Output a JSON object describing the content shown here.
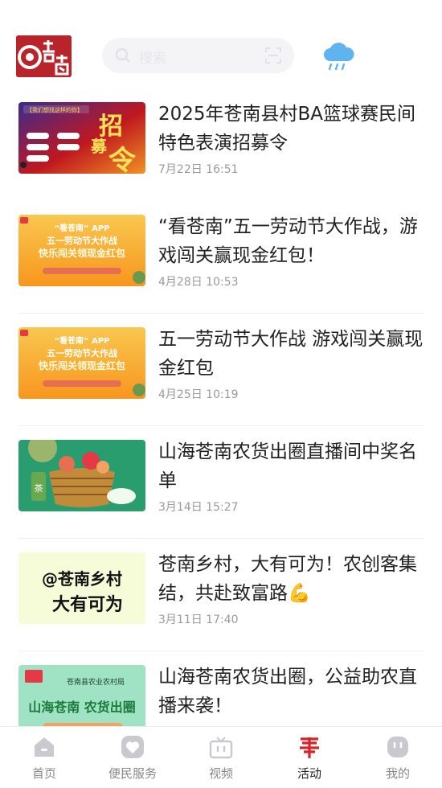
{
  "header": {
    "logo_text": "看苍南",
    "search_placeholder": "搜索",
    "weather_icon": "rain-cloud-icon"
  },
  "feed": [
    {
      "title": "2025年苍南县村BA篮球赛民间特色表演招募令",
      "time": "7月22日 16:51",
      "thumb": {
        "kind": "recruit",
        "caption": "【我们想找这样的你】",
        "big": "招募令"
      }
    },
    {
      "title": "“看苍南”五一劳动节大作战，游戏闯关赢现金红包！",
      "time": "4月28日 10:53",
      "thumb": {
        "kind": "mayday",
        "line1": "“看苍南” APP",
        "line2": "五一劳动节大作战",
        "line3": "快乐闯关领现金红包"
      }
    },
    {
      "title": "五一劳动节大作战 游戏闯关赢现金红包",
      "time": "4月25日 10:19",
      "thumb": {
        "kind": "mayday",
        "line1": "“看苍南” APP",
        "line2": "五一劳动节大作战",
        "line3": "快乐闯关领现金红包"
      }
    },
    {
      "title": "山海苍南农货出圈直播间中奖名单",
      "time": "3月14日 15:27",
      "thumb": {
        "kind": "basket",
        "tag": "茶"
      }
    },
    {
      "title": "苍南乡村，大有可为！农创客集结，共赴致富路💪",
      "time": "3月11日 17:40",
      "thumb": {
        "kind": "text",
        "line1": "@苍南乡村",
        "line2": "大有可为"
      }
    },
    {
      "title": "山海苍南农货出圈，公益助农直播来袭！",
      "time": "",
      "thumb": {
        "kind": "farm",
        "line1": "苍南县农业农村局",
        "line2": "山海苍南 农货出圈"
      }
    }
  ],
  "tabbar": [
    {
      "label": "首页",
      "icon": "home-icon",
      "active": false
    },
    {
      "label": "便民服务",
      "icon": "heart-icon",
      "active": false
    },
    {
      "label": "视频",
      "icon": "tv-icon",
      "active": false
    },
    {
      "label": "活动",
      "icon": "activity-icon",
      "active": true
    },
    {
      "label": "我的",
      "icon": "profile-icon",
      "active": false
    }
  ],
  "colors": {
    "brand_red": "#d6232a",
    "inactive_icon": "#c9c9cf",
    "title_text": "#222222",
    "time_text": "#9a9a9a"
  }
}
